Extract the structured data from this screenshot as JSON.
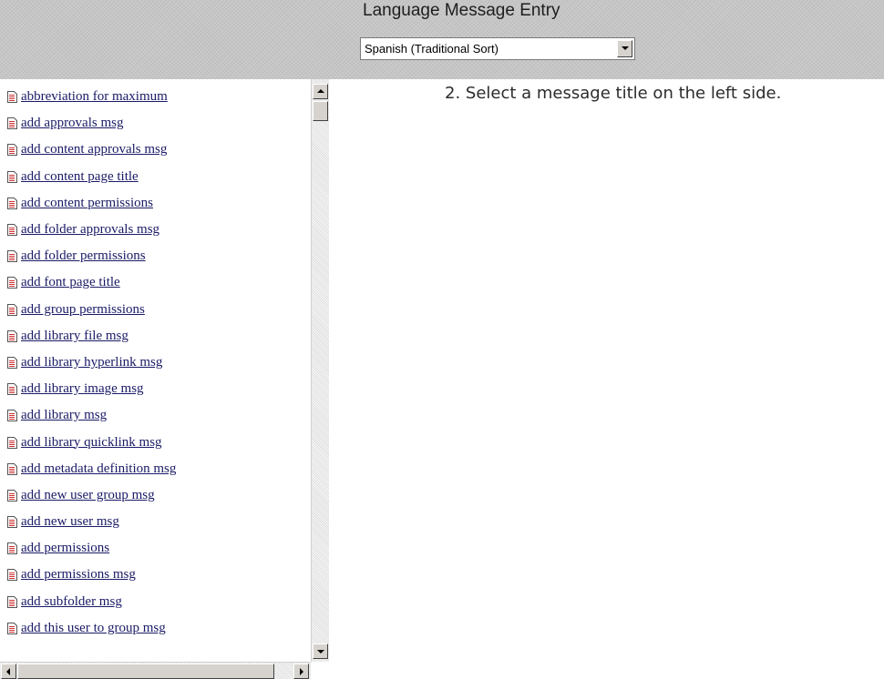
{
  "header": {
    "title": "Language Message Entry",
    "language_select": {
      "selected": "Spanish (Traditional Sort)"
    }
  },
  "message_list": {
    "items": [
      "abbreviation for maximum",
      "add approvals msg",
      "add content approvals msg",
      "add content page title",
      "add content permissions",
      "add folder approvals msg",
      "add folder permissions",
      "add font page title",
      "add group permissions",
      "add library file msg",
      "add library hyperlink msg",
      "add library image msg",
      "add library msg",
      "add library quicklink msg",
      "add metadata definition msg",
      "add new user group msg",
      "add new user msg",
      "add permissions",
      "add permissions msg",
      "add subfolder msg",
      "add this user to group msg"
    ],
    "item_icon": "document-icon"
  },
  "main": {
    "instruction": "2. Select a message title on the left side."
  },
  "colors": {
    "header_bg": "#c6c6c6",
    "link": "#1a1a66",
    "icon_accent": "#cc3333"
  }
}
